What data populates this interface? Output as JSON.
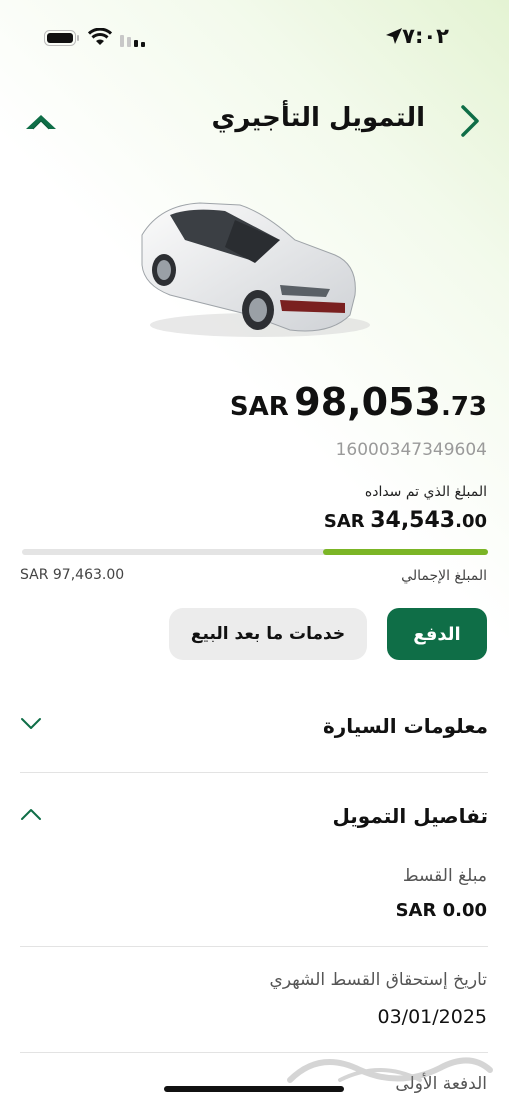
{
  "status_bar": {
    "time": "٧:٠٢"
  },
  "header": {
    "title": "التمويل التأجيري"
  },
  "summary": {
    "amount_currency": "SAR",
    "amount_integer": "98,053",
    "amount_decimal": ".73",
    "contract_number": "16000347349604",
    "paid_label": "المبلغ الذي تم سداده",
    "paid_currency": "SAR",
    "paid_integer": "34,543",
    "paid_decimal": ".00",
    "progress_fraction": 0.354,
    "total_label": "المبلغ الإجمالي",
    "total_amount": "SAR 97,463.00"
  },
  "actions": {
    "pay_label": "الدفع",
    "after_sales_label": "خدمات ما بعد البيع"
  },
  "sections": {
    "car_info_title": "معلومات السيارة",
    "finance_details_title": "تفاصيل التمويل"
  },
  "finance_details": {
    "installment_label": "مبلغ القسط",
    "installment_value": "SAR 0.00",
    "due_date_label": "تاريخ إستحقاق القسط الشهري",
    "due_date_value": "03/01/2025",
    "first_payment_label": "الدفعة الأولى"
  },
  "colors": {
    "primary": "#0f6e47",
    "progress": "#7bb526",
    "secondary_button": "#ececec"
  },
  "watermark_text": "حراج"
}
